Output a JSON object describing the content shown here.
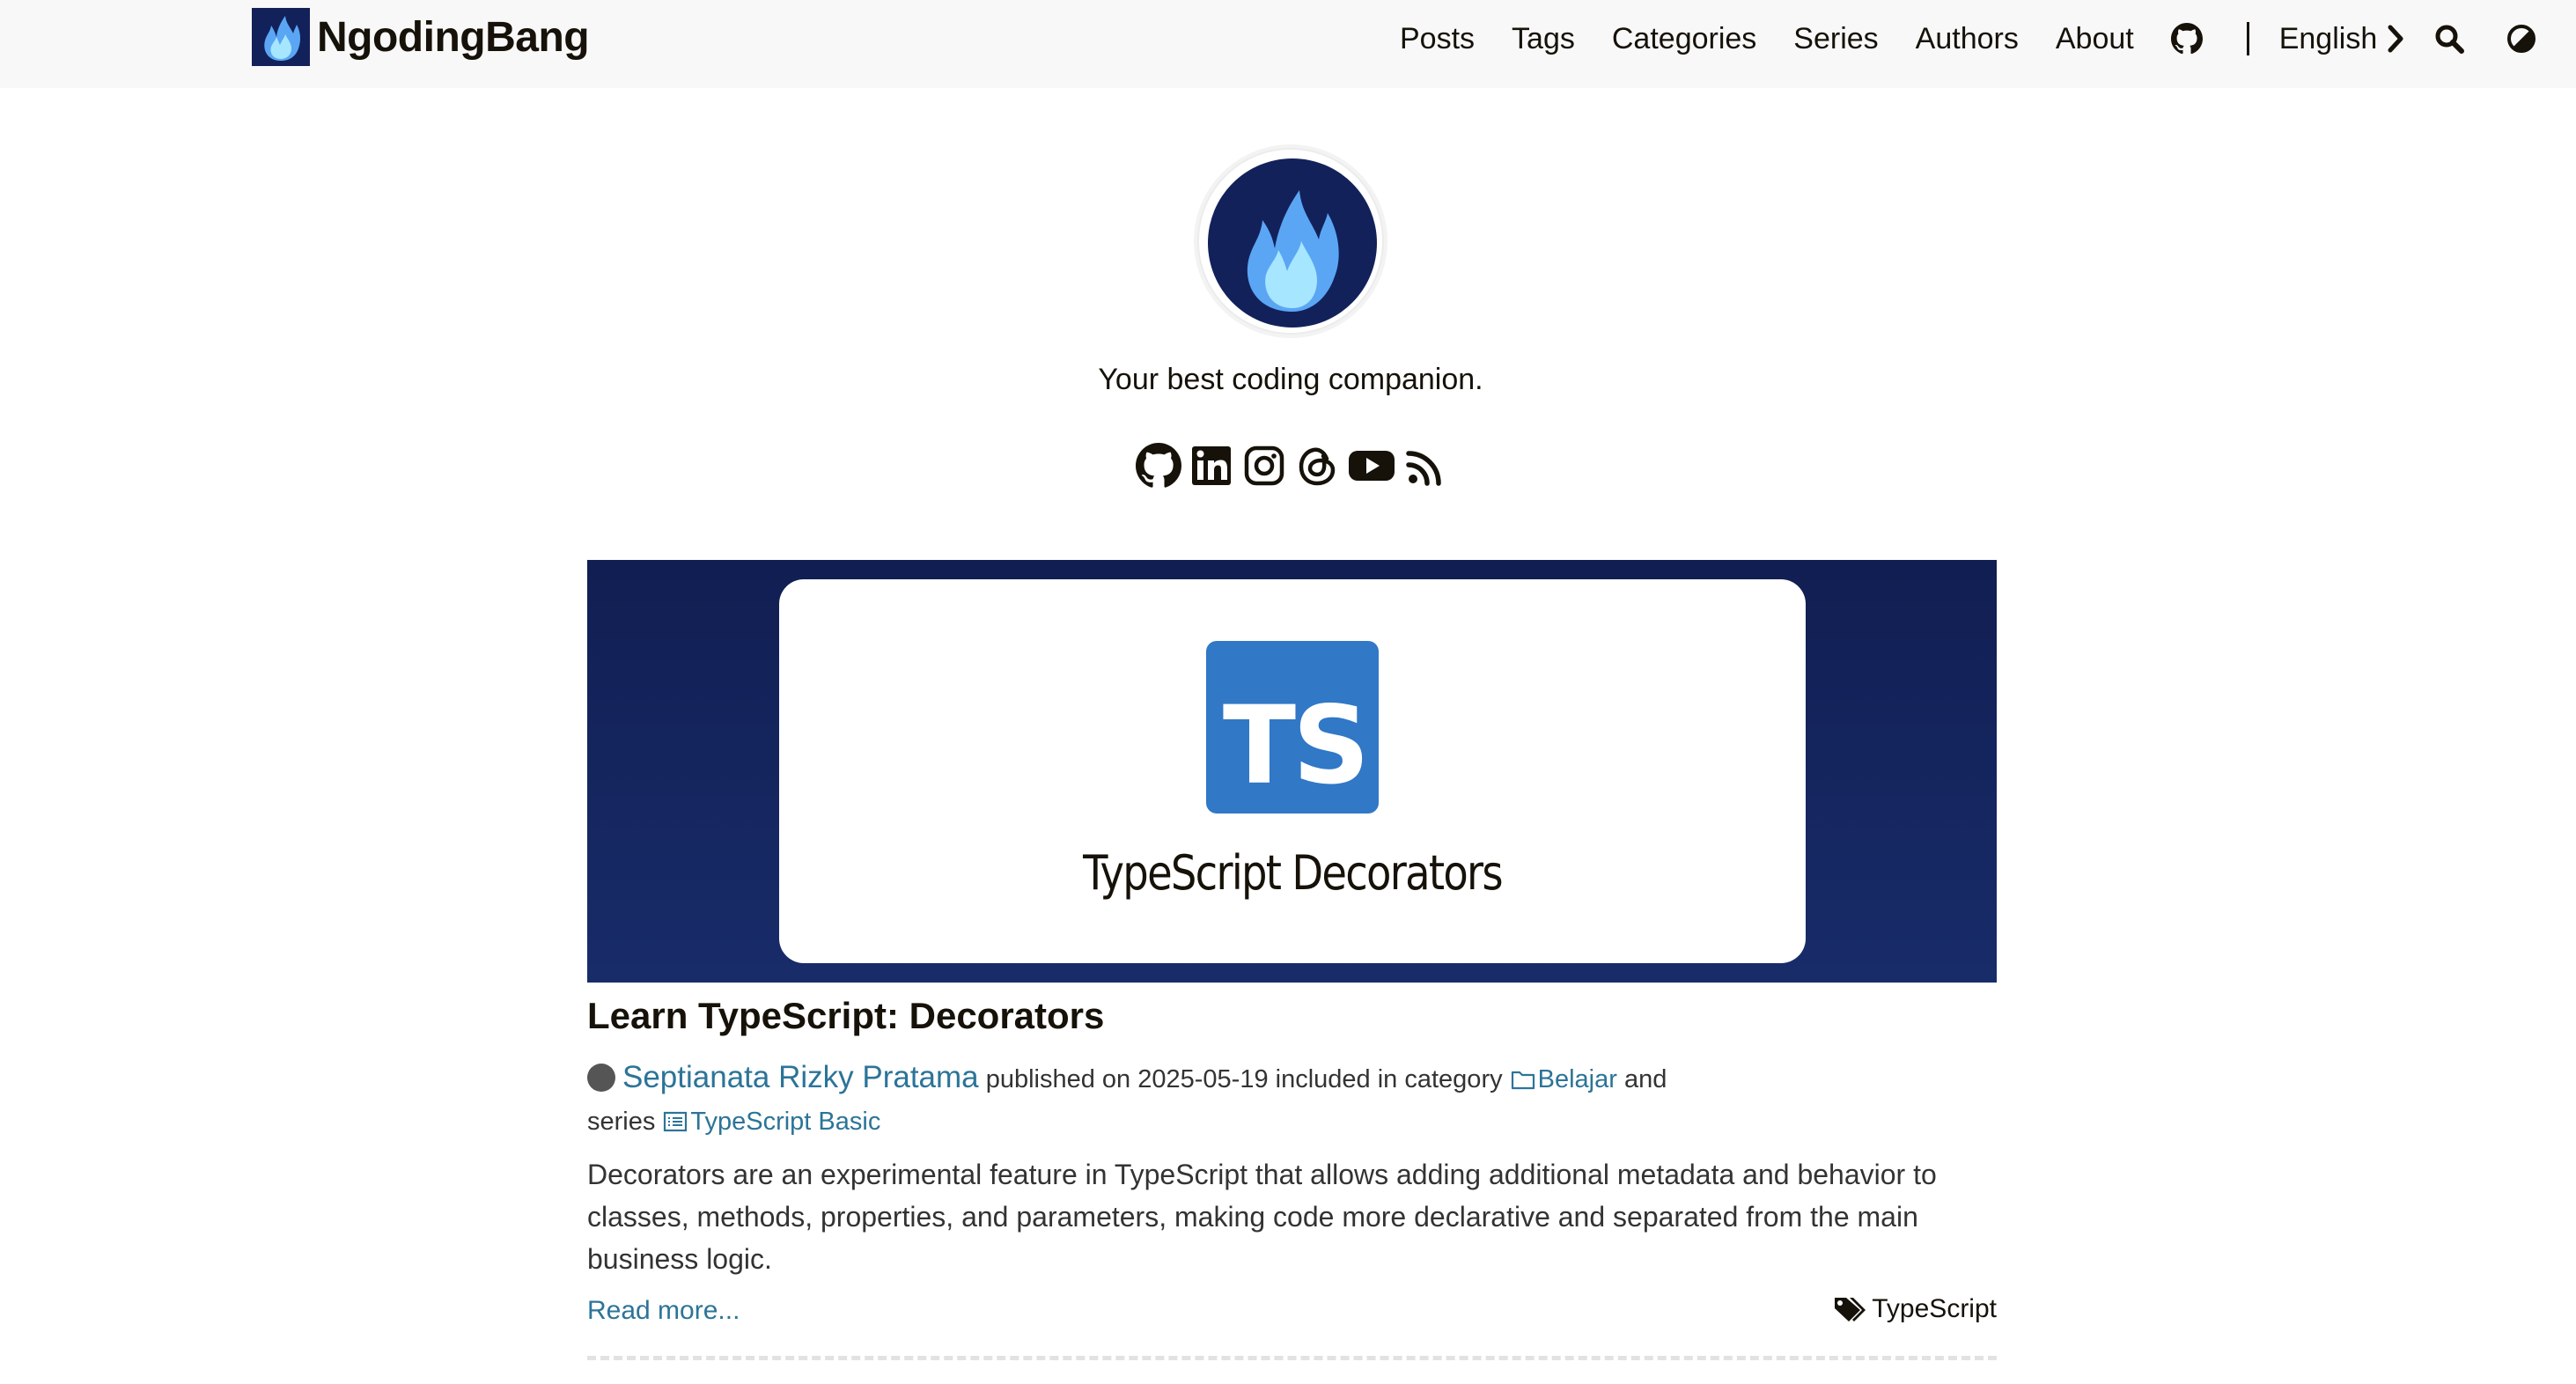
{
  "header": {
    "brand": "NgodingBang",
    "nav": {
      "posts": "Posts",
      "tags": "Tags",
      "categories": "Categories",
      "series": "Series",
      "authors": "Authors",
      "about": "About"
    },
    "language": "English",
    "icons": [
      "github-icon",
      "chevron-right-icon",
      "search-icon",
      "theme-toggle-icon"
    ]
  },
  "profile": {
    "tagline": "Your best coding companion.",
    "social": [
      "github-icon",
      "linkedin-icon",
      "instagram-icon",
      "threads-icon",
      "youtube-icon",
      "rss-icon"
    ]
  },
  "post": {
    "cover": {
      "logo_text": "TS",
      "title": "TypeScript Decorators"
    },
    "title": "Learn TypeScript: Decorators",
    "author": "Septianata Rizky Pratama",
    "published_prefix": "published on",
    "date": "2025-05-19",
    "category_prefix": "included in category",
    "category": "Belajar",
    "and": "and",
    "series_prefix": "series",
    "series": "TypeScript Basic",
    "excerpt": "Decorators are an experimental feature in TypeScript that allows adding additional metadata and behavior to classes, methods, properties, and parameters, making code more declarative and separated from the main business logic.",
    "read_more": "Read more...",
    "tag": "TypeScript"
  },
  "colors": {
    "link": "#2c7498",
    "header_bg": "#f8f8f8",
    "cover_bg": "#111e52",
    "ts_blue": "#3178c6"
  }
}
